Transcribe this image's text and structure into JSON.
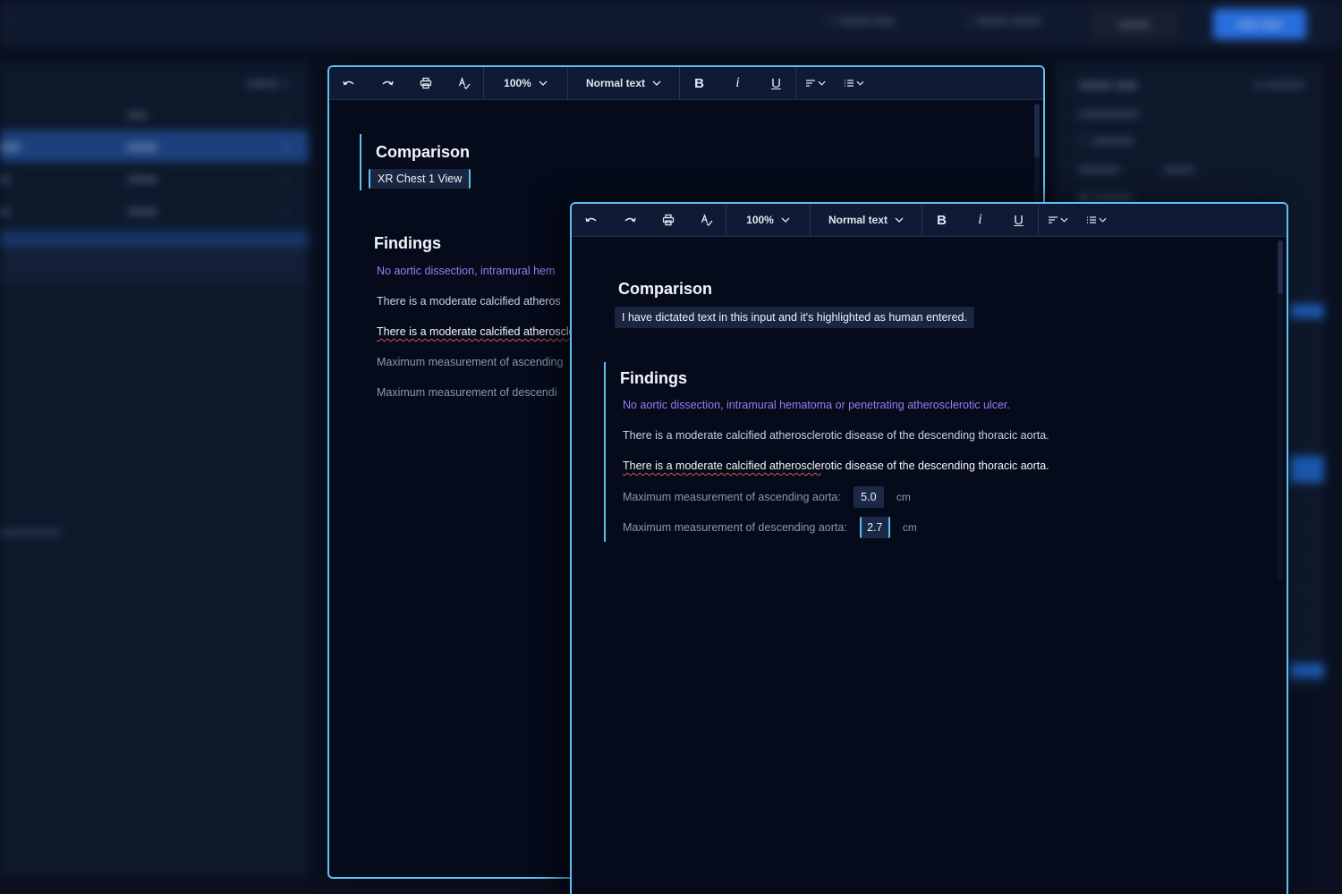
{
  "editor_front": {
    "toolbar": {
      "zoom": "100%",
      "text_style": "Normal text",
      "bold": "B",
      "italic": "i",
      "underline": "U"
    },
    "comparison": {
      "heading": "Comparison",
      "input_value": "I have dictated text in this input and it's highlighted as human entered."
    },
    "findings": {
      "heading": "Findings",
      "line1": "No aortic dissection, intramural hematoma or penetrating atherosclerotic ulcer.",
      "line2": "There is a moderate calcified atherosclerotic disease of the descending thoracic aorta.",
      "line3_marked": "There is a moderate calcified atheroscle",
      "line3_rest": "rotic disease of the descending thoracic aorta.",
      "ascending_label": "Maximum measurement of ascending aorta:",
      "ascending_value": "5.0",
      "ascending_unit": "cm",
      "descending_label": "Maximum measurement of descending aorta:",
      "descending_value": "2.7",
      "descending_unit": "cm"
    }
  },
  "editor_back": {
    "toolbar": {
      "zoom": "100%",
      "text_style": "Normal text",
      "bold": "B",
      "italic": "i",
      "underline": "U"
    },
    "comparison": {
      "heading": "Comparison",
      "input_value": "XR Chest 1 View"
    },
    "findings": {
      "heading": "Findings",
      "line1": "No aortic dissection, intramural hem",
      "line2": "There is a moderate calcified atheros",
      "line3": "There is a moderate calcified atheroscle",
      "line4": "Maximum measurement of ascending",
      "line5": "Maximum measurement of descendi"
    }
  },
  "colors": {
    "accent": "#5cc1ec",
    "background": "#050b1b",
    "toolbar": "#0f1b34",
    "purple_text": "#9b7cf2",
    "spell_error": "#e0524d"
  },
  "icons": [
    "undo-icon",
    "redo-icon",
    "print-icon",
    "spellcheck-icon",
    "chevron-down-icon",
    "align-icon",
    "list-icon"
  ]
}
